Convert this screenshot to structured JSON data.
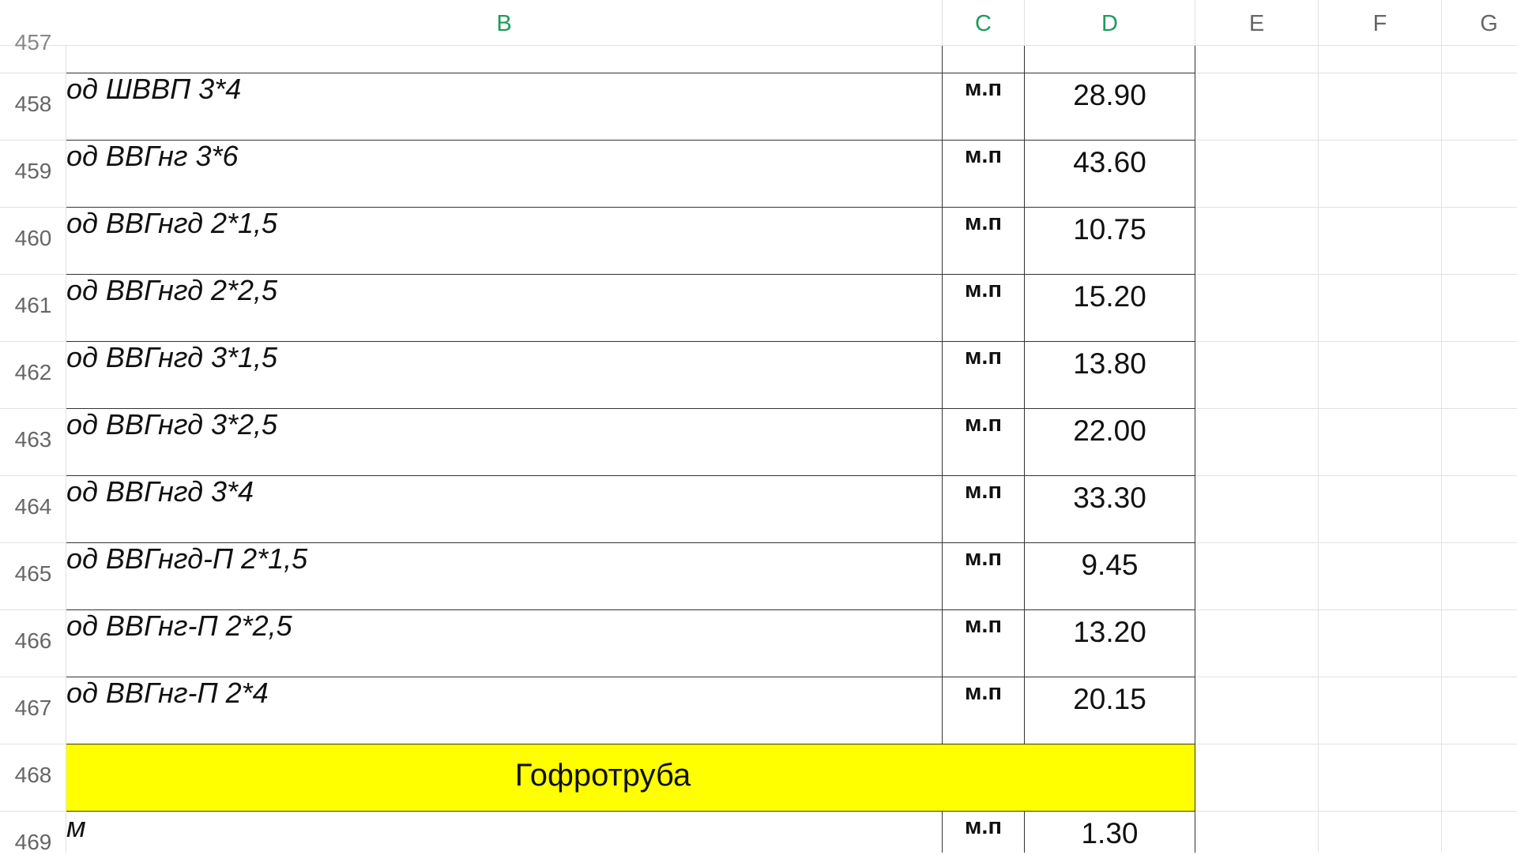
{
  "columns": [
    "B",
    "C",
    "D",
    "E",
    "F",
    "G"
  ],
  "selected_columns": [
    "B",
    "C",
    "D"
  ],
  "rows": [
    {
      "num": "458",
      "name": "од ШВВП 3*4",
      "unit": "м.п",
      "price": "28.90"
    },
    {
      "num": "459",
      "name": "од ВВГнг 3*6",
      "unit": "м.п",
      "price": "43.60"
    },
    {
      "num": "460",
      "name": "од ВВГнгд 2*1,5",
      "unit": "м.п",
      "price": "10.75"
    },
    {
      "num": "461",
      "name": "од ВВГнгд 2*2,5",
      "unit": "м.п",
      "price": "15.20"
    },
    {
      "num": "462",
      "name": "од ВВГнгд 3*1,5",
      "unit": "м.п",
      "price": "13.80"
    },
    {
      "num": "463",
      "name": "од ВВГнгд 3*2,5",
      "unit": "м.п",
      "price": "22.00"
    },
    {
      "num": "464",
      "name": "од ВВГнгд 3*4",
      "unit": "м.п",
      "price": "33.30"
    },
    {
      "num": "465",
      "name": "од ВВГнгд-П 2*1,5",
      "unit": "м.п",
      "price": "9.45"
    },
    {
      "num": "466",
      "name": "од ВВГнг-П 2*2,5",
      "unit": "м.п",
      "price": "13.20"
    },
    {
      "num": "467",
      "name": "од ВВГнг-П 2*4",
      "unit": "м.п",
      "price": "20.15"
    }
  ],
  "section": {
    "num": "468",
    "label": "Гофротруба"
  },
  "last_row": {
    "num": "469",
    "name": "м",
    "unit": "м.п",
    "price": "1.30"
  },
  "colors": {
    "selected_header": "#1a9c5b",
    "section_fill": "#ffff00",
    "grid": "#e2e2e2",
    "border": "#333333"
  }
}
